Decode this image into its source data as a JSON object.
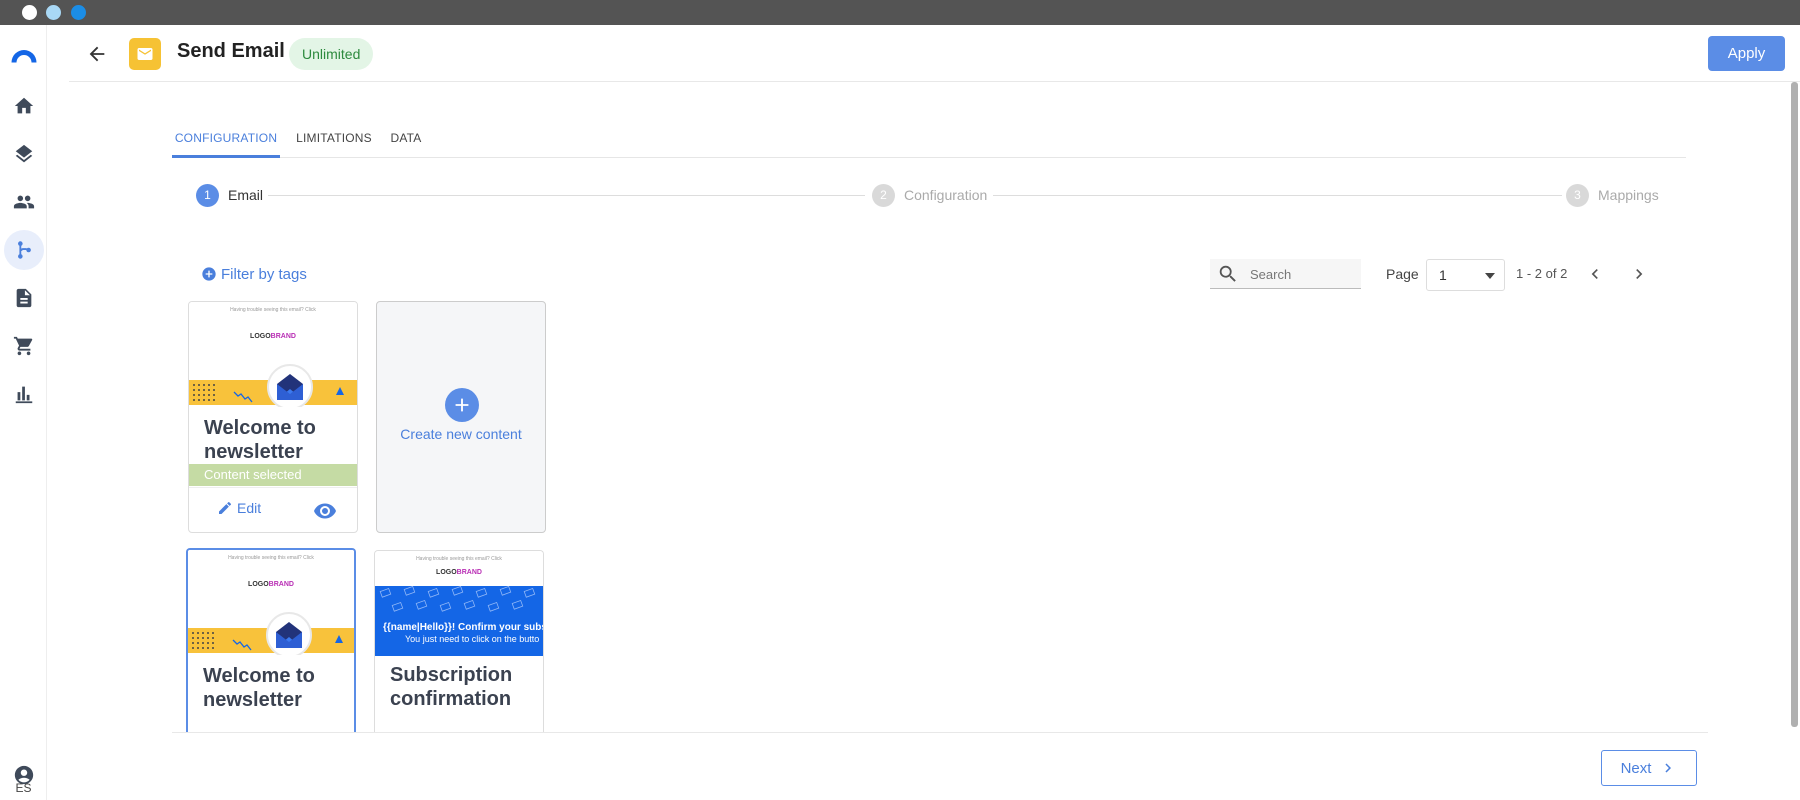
{
  "window": {
    "dots": [
      "#ffffff",
      "#a9d8f5",
      "#1b8de6"
    ]
  },
  "sidebar": {
    "items": [
      {
        "name": "logo-icon"
      },
      {
        "name": "home-icon"
      },
      {
        "name": "layers-icon"
      },
      {
        "name": "people-icon"
      },
      {
        "name": "flow-icon",
        "active": true
      },
      {
        "name": "document-icon"
      },
      {
        "name": "cart-icon"
      },
      {
        "name": "chart-icon"
      }
    ],
    "user_language": "ES"
  },
  "header": {
    "title": "Send Email",
    "badge": "Unlimited",
    "apply_label": "Apply"
  },
  "tabs": [
    {
      "label": "CONFIGURATION",
      "active": true
    },
    {
      "label": "LIMITATIONS",
      "active": false
    },
    {
      "label": "DATA",
      "active": false
    }
  ],
  "stepper": [
    {
      "number": "1",
      "label": "Email",
      "active": true
    },
    {
      "number": "2",
      "label": "Configuration",
      "active": false
    },
    {
      "number": "3",
      "label": "Mappings",
      "active": false
    }
  ],
  "toolbar": {
    "filter_label": "Filter by tags",
    "search_placeholder": "Search",
    "page_label": "Page",
    "page_value": "1",
    "range_text": "1 - 2 of 2"
  },
  "cards": {
    "card1": {
      "title_line1": "Welcome to",
      "title_line2": "newsletter",
      "status": "Content selected",
      "edit_label": "Edit",
      "thumb_tiny": "Having trouble seeing this email? Click",
      "thumb_logo_a": "LOGO",
      "thumb_logo_b": "BRAND"
    },
    "create": {
      "label": "Create new content"
    },
    "card2": {
      "title_line1": "Welcome to",
      "title_line2": "newsletter",
      "thumb_tiny": "Having trouble seeing this email? Click",
      "thumb_logo_a": "LOGO",
      "thumb_logo_b": "BRAND"
    },
    "card3": {
      "title_line1": "Subscription",
      "title_line2": "confirmation",
      "thumb_tiny": "Having trouble seeing this email? Click",
      "thumb_logo_a": "LOGO",
      "thumb_logo_b": "BRAND",
      "thumb_line1": "{{name|Hello}}! Confirm your subscr",
      "thumb_line2": "You just need to click on the butto"
    }
  },
  "footer": {
    "next_label": "Next"
  }
}
